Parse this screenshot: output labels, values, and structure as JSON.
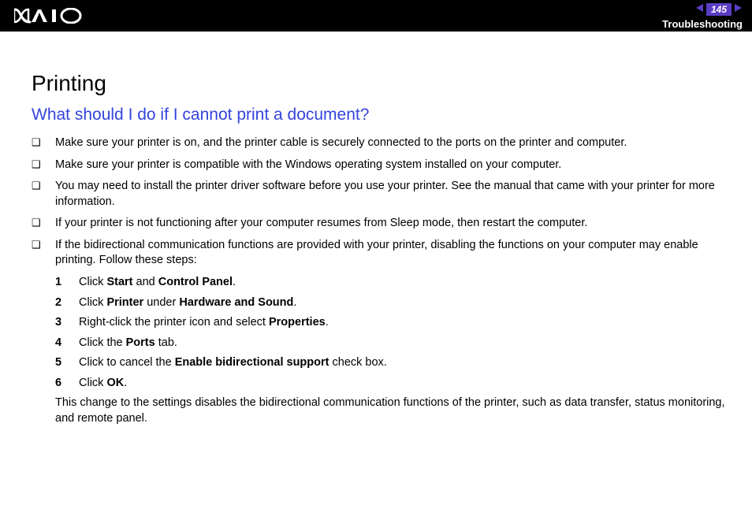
{
  "header": {
    "page_number": "145",
    "section": "Troubleshooting"
  },
  "content": {
    "title": "Printing",
    "question": "What should I do if I cannot print a document?",
    "bullets": [
      "Make sure your printer is on, and the printer cable is securely connected to the ports on the printer and computer.",
      "Make sure your printer is compatible with the Windows operating system installed on your computer.",
      "You may need to install the printer driver software before you use your printer. See the manual that came with your printer for more information.",
      "If your printer is not functioning after your computer resumes from Sleep mode, then restart the computer.",
      "If the bidirectional communication functions are provided with your printer, disabling the functions on your computer may enable printing. Follow these steps:"
    ],
    "steps": [
      {
        "num": "1",
        "html": "Click <b>Start</b> and <b>Control Panel</b>."
      },
      {
        "num": "2",
        "html": "Click <b>Printer</b> under <b>Hardware and Sound</b>."
      },
      {
        "num": "3",
        "html": "Right-click the printer icon and select <b>Properties</b>."
      },
      {
        "num": "4",
        "html": "Click the <b>Ports</b> tab."
      },
      {
        "num": "5",
        "html": "Click to cancel the <b>Enable bidirectional support</b> check box."
      },
      {
        "num": "6",
        "html": "Click <b>OK</b>."
      }
    ],
    "followup": "This change to the settings disables the bidirectional communication functions of the printer, such as data transfer, status monitoring, and remote panel."
  }
}
